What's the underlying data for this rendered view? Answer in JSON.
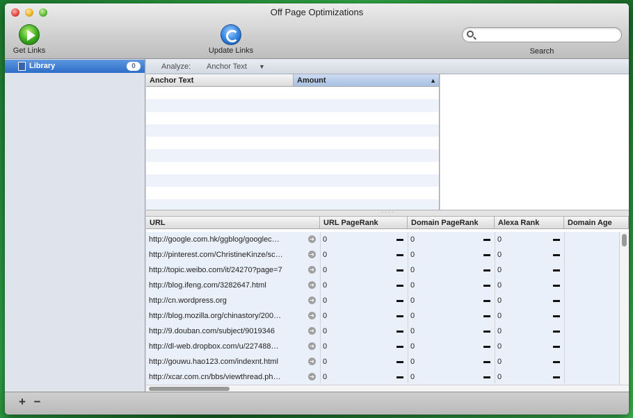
{
  "window": {
    "title": "Off Page Optimizations"
  },
  "toolbar": {
    "get_links_label": "Get Links",
    "update_links_label": "Update Links",
    "search_label": "Search",
    "search_placeholder": ""
  },
  "sidebar": {
    "items": [
      {
        "label": "Library",
        "count": "0"
      }
    ]
  },
  "analyze": {
    "label": "Analyze:",
    "value": "Anchor Text"
  },
  "anchor_table": {
    "columns": [
      "Anchor Text",
      "Amount"
    ],
    "sorted_column": "Amount"
  },
  "url_table": {
    "columns": [
      "URL",
      "URL PageRank",
      "Domain PageRank",
      "Alexa Rank",
      "Domain Age"
    ],
    "rows": [
      {
        "url": "http://google.com.hk/ggblog/googlec…",
        "url_pr": "0",
        "domain_pr": "0",
        "alexa": "0"
      },
      {
        "url": "http://pinterest.com/ChristineKinze/sc…",
        "url_pr": "0",
        "domain_pr": "0",
        "alexa": "0"
      },
      {
        "url": "http://topic.weibo.com/it/24270?page=7",
        "url_pr": "0",
        "domain_pr": "0",
        "alexa": "0"
      },
      {
        "url": "http://blog.ifeng.com/3282647.html",
        "url_pr": "0",
        "domain_pr": "0",
        "alexa": "0"
      },
      {
        "url": "http://cn.wordpress.org",
        "url_pr": "0",
        "domain_pr": "0",
        "alexa": "0"
      },
      {
        "url": "http://blog.mozilla.org/chinastory/200…",
        "url_pr": "0",
        "domain_pr": "0",
        "alexa": "0"
      },
      {
        "url": "http://9.douban.com/subject/9019346",
        "url_pr": "0",
        "domain_pr": "0",
        "alexa": "0"
      },
      {
        "url": "http://dl-web.dropbox.com/u/227488…",
        "url_pr": "0",
        "domain_pr": "0",
        "alexa": "0"
      },
      {
        "url": "http://gouwu.hao123.com/indexnt.html",
        "url_pr": "0",
        "domain_pr": "0",
        "alexa": "0"
      },
      {
        "url": "http://xcar.com.cn/bbs/viewthread.ph…",
        "url_pr": "0",
        "domain_pr": "0",
        "alexa": "0"
      }
    ]
  },
  "bottom": {
    "add_label": "+",
    "remove_label": "−"
  },
  "colors": {
    "selection": "#2e6cc8",
    "row_tint": "#eaf0f9"
  }
}
